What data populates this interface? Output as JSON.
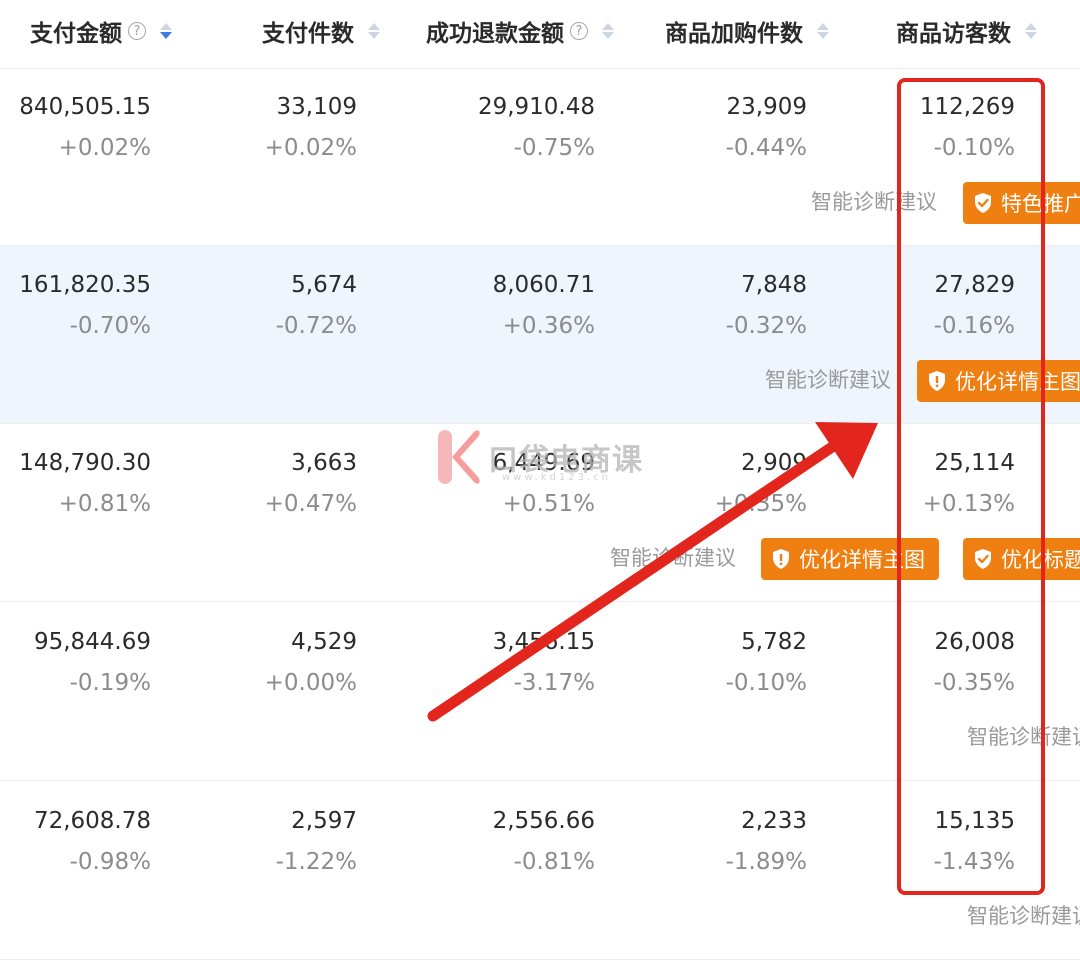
{
  "headers": [
    {
      "label": "支付金额",
      "help": "?",
      "sort": "active-down"
    },
    {
      "label": "支付件数",
      "sort": "idle"
    },
    {
      "label": "成功退款金额",
      "help": "?",
      "sort": "idle"
    },
    {
      "label": "商品加购件数",
      "sort": "idle"
    },
    {
      "label": "商品访客数",
      "sort": "idle"
    }
  ],
  "rows": [
    {
      "cells": [
        [
          "840,505.15",
          "+0.02%"
        ],
        [
          "33,109",
          "+0.02%"
        ],
        [
          "29,910.48",
          "-0.75%"
        ],
        [
          "23,909",
          "-0.44%"
        ],
        [
          "112,269",
          "-0.10%"
        ]
      ],
      "diagnosis": "智能诊断建议",
      "tags": [
        "特色推广"
      ]
    },
    {
      "cells": [
        [
          "161,820.35",
          "-0.70%"
        ],
        [
          "5,674",
          "-0.72%"
        ],
        [
          "8,060.71",
          "+0.36%"
        ],
        [
          "7,848",
          "-0.32%"
        ],
        [
          "27,829",
          "-0.16%"
        ]
      ],
      "diagnosis": "智能诊断建议",
      "tags": [
        "优化详情主图"
      ]
    },
    {
      "cells": [
        [
          "148,790.30",
          "+0.81%"
        ],
        [
          "3,663",
          "+0.47%"
        ],
        [
          "6,449.69",
          "+0.51%"
        ],
        [
          "2,909",
          "+0.35%"
        ],
        [
          "25,114",
          "+0.13%"
        ]
      ],
      "diagnosis": "智能诊断建议",
      "tags": [
        "优化详情主图",
        "优化标题"
      ]
    },
    {
      "cells": [
        [
          "95,844.69",
          "-0.19%"
        ],
        [
          "4,529",
          "+0.00%"
        ],
        [
          "3,456.15",
          "-3.17%"
        ],
        [
          "5,782",
          "-0.10%"
        ],
        [
          "26,008",
          "-0.35%"
        ]
      ],
      "diagnosis": "智能诊断建议",
      "tags": []
    },
    {
      "cells": [
        [
          "72,608.78",
          "-0.98%"
        ],
        [
          "2,597",
          "-1.22%"
        ],
        [
          "2,556.66",
          "-0.81%"
        ],
        [
          "2,233",
          "-1.89%"
        ],
        [
          "15,135",
          "-1.43%"
        ]
      ],
      "diagnosis": "智能诊断建议",
      "tags": []
    }
  ],
  "watermark": {
    "text": "口袋电商课",
    "url": "www.kd123.cn"
  },
  "colors": {
    "accent_orange": "#f07f12",
    "annotation_red": "#e3261d",
    "highlight_row": "#eef5fd",
    "sort_active": "#3a7bea"
  }
}
